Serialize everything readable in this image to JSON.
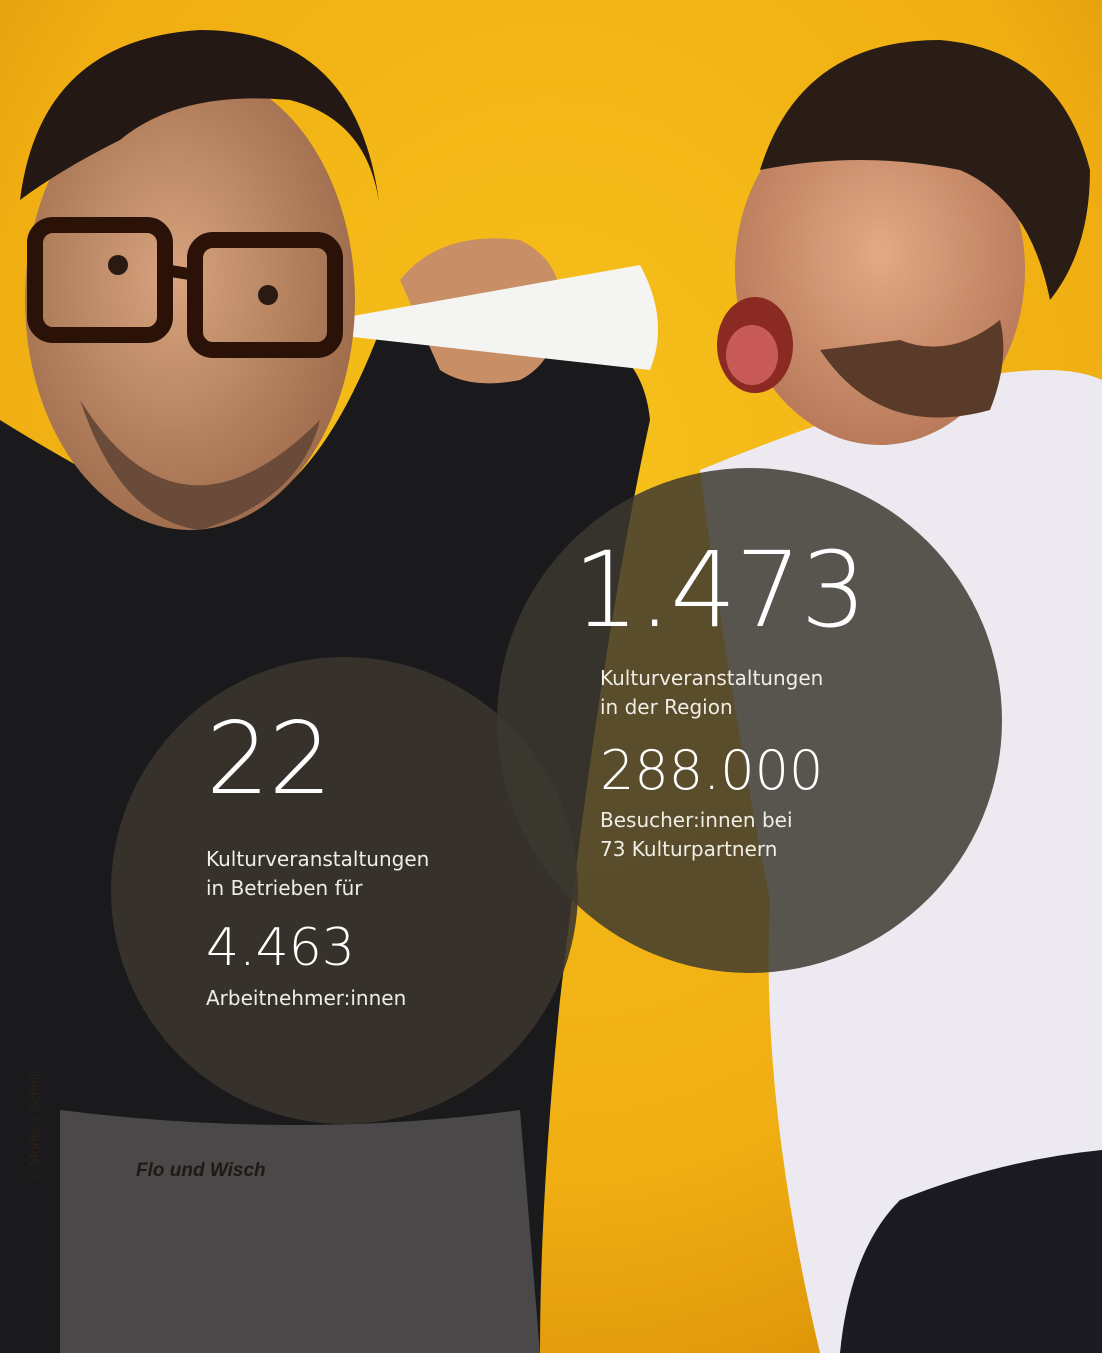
{
  "photo": {
    "background_color": "#f2b416",
    "caption": "Flo und Wisch",
    "credit": "© Moritz + Schell"
  },
  "stats_left": {
    "number": "22",
    "label_line1": "Kulturveranstaltungen",
    "label_line2": "in Betrieben für",
    "secondary_number": "4.463",
    "secondary_label": "Arbeitnehmer:innen"
  },
  "stats_right": {
    "number": "1.473",
    "label_line1": "Kulturveranstaltungen",
    "label_line2": "in der Region",
    "secondary_number": "288.000",
    "secondary_label_line1": "Besucher:innen bei",
    "secondary_label_line2": "73 Kulturpartnern"
  }
}
